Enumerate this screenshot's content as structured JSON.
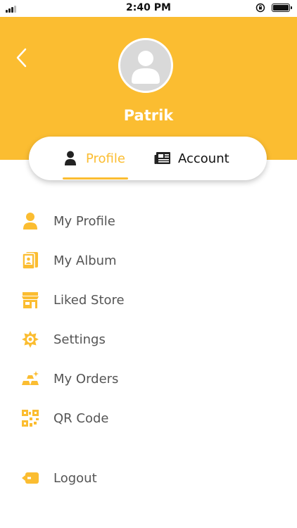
{
  "status_bar": {
    "time": "2:40 PM"
  },
  "header": {
    "user_name": "Patrik"
  },
  "tabs": [
    {
      "label": "Profile",
      "active": true
    },
    {
      "label": "Account",
      "active": false
    }
  ],
  "menu": {
    "items": [
      {
        "label": "My Profile",
        "icon": "person-icon"
      },
      {
        "label": "My Album",
        "icon": "album-icon"
      },
      {
        "label": "Liked Store",
        "icon": "store-icon"
      },
      {
        "label": "Settings",
        "icon": "gear-icon"
      },
      {
        "label": "My Orders",
        "icon": "gold-bars-icon"
      },
      {
        "label": "QR Code",
        "icon": "qr-code-icon"
      }
    ],
    "logout_label": "Logout"
  },
  "colors": {
    "accent": "#fbbd31",
    "text": "#555555",
    "avatar_bg": "#d9d9d9"
  }
}
